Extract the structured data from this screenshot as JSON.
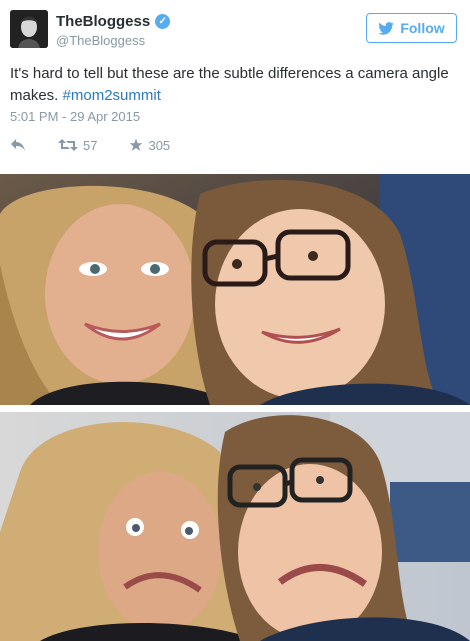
{
  "tweet": {
    "display_name": "TheBloggess",
    "handle": "@TheBloggess",
    "follow_label": "Follow",
    "text": "It's hard to tell but these are the subtle differences a camera angle makes. ",
    "hashtag": "#mom2summit",
    "timestamp": "5:01 PM - 29 Apr 2015",
    "retweets": "57",
    "favorites": "305"
  },
  "icons": {
    "verified": "verified-badge-icon",
    "follow": "twitter-bird-icon",
    "reply": "reply-icon",
    "retweet": "retweet-icon",
    "favorite": "star-icon"
  },
  "colors": {
    "accent": "#55acee",
    "link": "#2b7bb9",
    "muted": "#8899a6",
    "text": "#292f33"
  }
}
